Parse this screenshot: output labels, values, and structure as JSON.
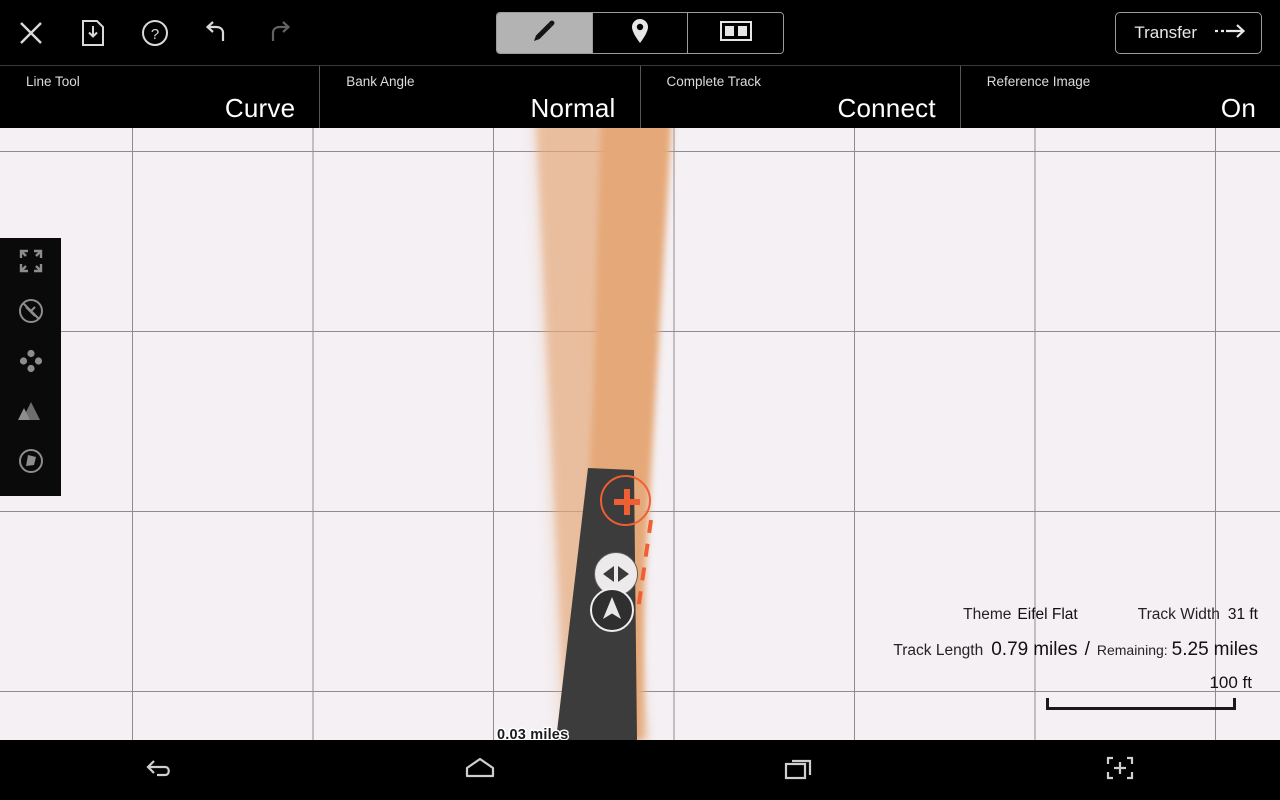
{
  "toolbar": {
    "buttons": [
      {
        "name": "close-icon",
        "label": "Close"
      },
      {
        "name": "save-icon",
        "label": "Save"
      },
      {
        "name": "help-icon",
        "label": "Help"
      },
      {
        "name": "undo-icon",
        "label": "Undo"
      },
      {
        "name": "redo-icon",
        "label": "Redo"
      }
    ],
    "tabs": [
      {
        "name": "tab-draw",
        "icon": "pencil-icon",
        "active": true
      },
      {
        "name": "tab-markers",
        "icon": "map-pin-icon",
        "active": false
      },
      {
        "name": "tab-split-view",
        "icon": "split-view-icon",
        "active": false
      }
    ],
    "transfer_label": "Transfer"
  },
  "options": [
    {
      "label": "Line Tool",
      "value": "Curve"
    },
    {
      "label": "Bank Angle",
      "value": "Normal"
    },
    {
      "label": "Complete Track",
      "value": "Connect"
    },
    {
      "label": "Reference Image",
      "value": "On"
    }
  ],
  "rail": [
    {
      "name": "fullscreen-icon"
    },
    {
      "name": "no-snap-icon"
    },
    {
      "name": "four-dots-icon"
    },
    {
      "name": "terrain-icon"
    },
    {
      "name": "layers-icon"
    }
  ],
  "canvas": {
    "segment_distance_label": "0.03 miles",
    "track_color": "#e5a878",
    "track_dark_color": "#3c3c3c",
    "accent_color": "#ef5f33",
    "background_color": "#f4f0f4",
    "grid_color": "#6f6a70"
  },
  "info": {
    "theme_label": "Theme",
    "theme_value": "Eifel Flat",
    "track_width_label": "Track Width",
    "track_width_value": "31 ft",
    "track_length_label": "Track Length",
    "track_length_value": "0.79",
    "track_length_unit": "miles",
    "separator": "/",
    "remaining_label": "Remaining:",
    "remaining_value": "5.25",
    "remaining_unit": "miles"
  },
  "scale": {
    "value": "100 ft"
  },
  "navbar": [
    {
      "name": "android-back-icon"
    },
    {
      "name": "android-home-icon"
    },
    {
      "name": "android-recents-icon"
    },
    {
      "name": "android-screenshot-icon"
    }
  ]
}
